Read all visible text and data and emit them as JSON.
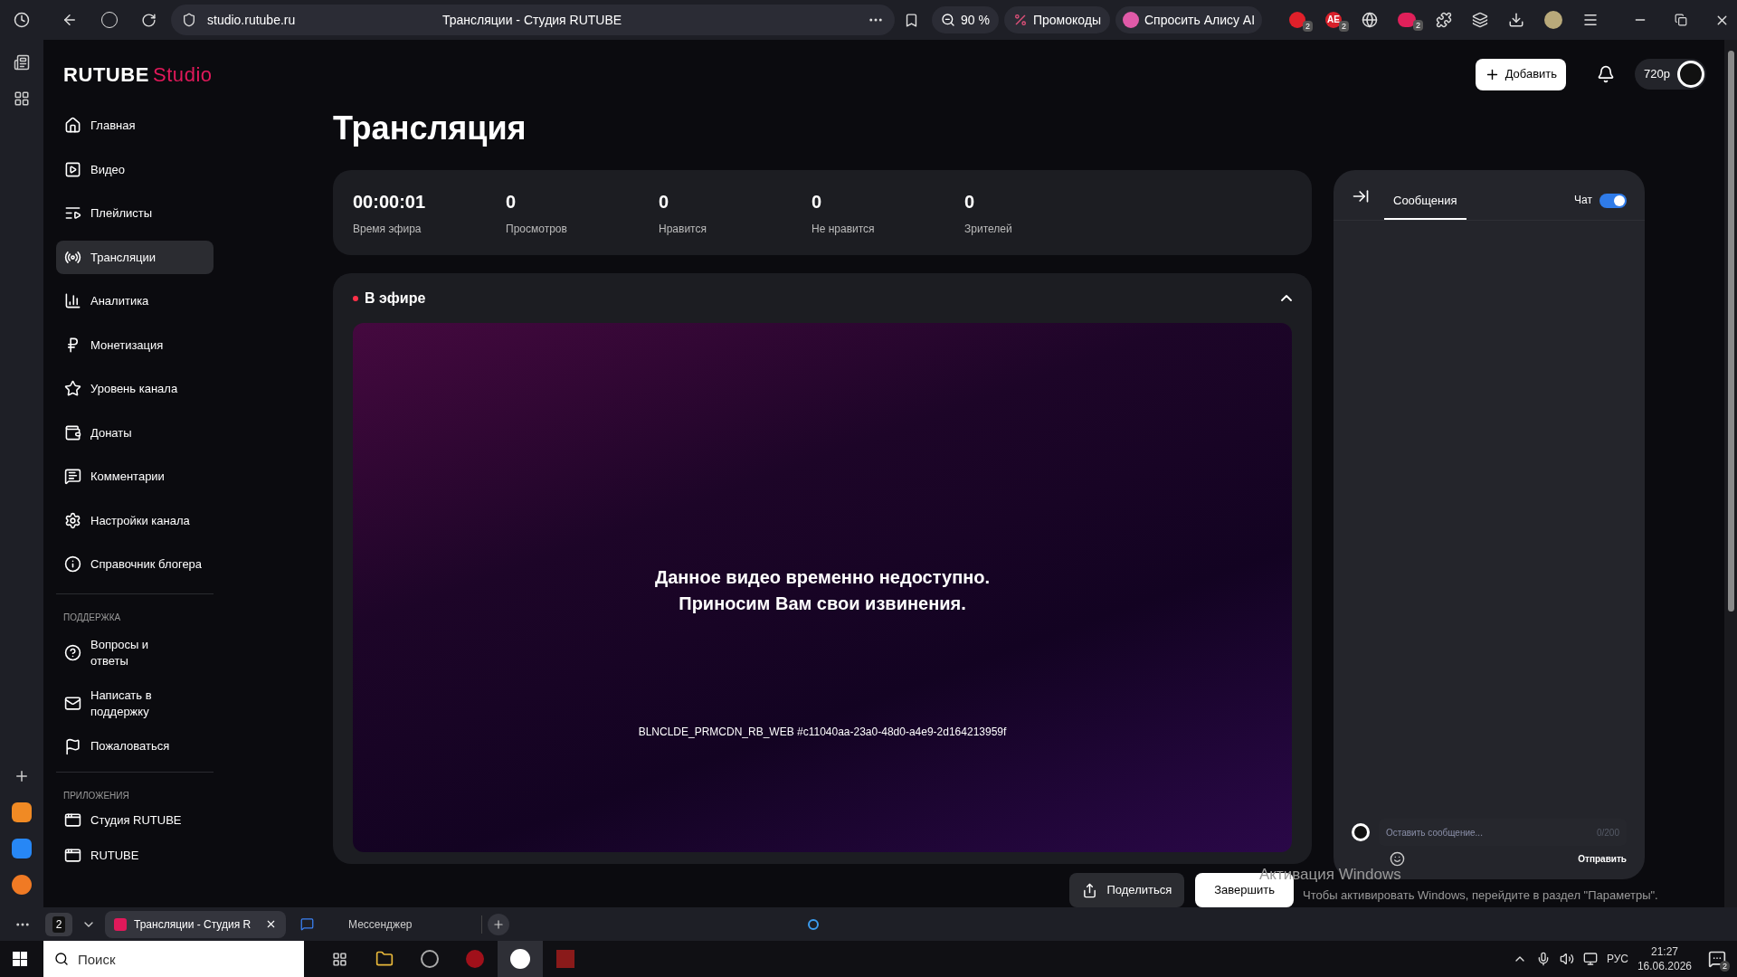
{
  "browser": {
    "url": "studio.rutube.ru",
    "title": "Трансляции - Студия RUTUBE",
    "zoom": "90 %",
    "promo": "Промокоды",
    "alice": "Спросить Алису AI",
    "extensions": [
      {
        "kind": "red",
        "badge": "2"
      },
      {
        "kind": "text",
        "text": "AE",
        "badge": "2"
      },
      {
        "kind": "globe"
      },
      {
        "kind": "pink",
        "badge": "2"
      },
      {
        "kind": "puzzle"
      },
      {
        "kind": "collections"
      },
      {
        "kind": "download"
      },
      {
        "kind": "avatar"
      },
      {
        "kind": "menu"
      }
    ]
  },
  "studio": {
    "logo": "RUTUBE",
    "logo_suffix": "Studio",
    "nav": [
      {
        "label": "Главная",
        "selected": false
      },
      {
        "label": "Видео",
        "selected": false
      },
      {
        "label": "Плейлисты",
        "selected": false
      },
      {
        "label": "Трансляции",
        "selected": true
      },
      {
        "label": "Аналитика",
        "selected": false
      },
      {
        "label": "Монетизация",
        "selected": false
      },
      {
        "label": "Уровень канала",
        "selected": false
      },
      {
        "label": "Донаты",
        "selected": false
      },
      {
        "label": "Комментарии",
        "selected": false
      },
      {
        "label": "Настройки канала",
        "selected": false
      },
      {
        "label": "Справочник блогера",
        "selected": false
      }
    ],
    "support": {
      "heading": "ПОДДЕРЖКА",
      "items": [
        "Вопросы и ответы",
        "Написать в поддержку",
        "Пожаловаться"
      ]
    },
    "apps": {
      "heading": "ПРИЛОЖЕНИЯ",
      "items": [
        "Студия RUTUBE",
        "RUTUBE"
      ]
    }
  },
  "header": {
    "add_button": "Добавить",
    "quality": "720p"
  },
  "page": {
    "title": "Трансляция",
    "stats": [
      {
        "value": "00:00:01",
        "label": "Время эфира"
      },
      {
        "value": "0",
        "label": "Просмотров"
      },
      {
        "value": "0",
        "label": "Нравится"
      },
      {
        "value": "0",
        "label": "Не нравится"
      },
      {
        "value": "0",
        "label": "Зрителей"
      }
    ],
    "stream": {
      "status": "В эфире",
      "expanded": true,
      "message": [
        "Данное видео временно недоступно.",
        "Приносим Вам свои извинения."
      ],
      "code": "BLNCLDE_PRMCDN_RB_WEB #c11040aa-23a0-48d0-a4e9-2d164213959f"
    },
    "actions": {
      "share": "Поделиться",
      "finish": "Завершить"
    }
  },
  "chat": {
    "tab": {
      "label": "Сообщения",
      "selected": true
    },
    "toggle": {
      "label": "Чат",
      "on": true
    },
    "placeholder": "Оставить сообщение...",
    "counter": "0/200",
    "send": "Отправить"
  },
  "activation": {
    "title": "Активация Windows",
    "text": "Чтобы активировать Windows, перейдите в раздел \"Параметры\"."
  },
  "tabbar": {
    "count": "2",
    "tabs": [
      {
        "title": "Трансляции - Студия R",
        "selected": true
      },
      {
        "title": "Мессенджер",
        "selected": false
      }
    ]
  },
  "taskbar": {
    "search": {
      "placeholder": "Поиск"
    },
    "lang": "РУС",
    "time": "21:27",
    "date": "16.06.2026",
    "notifications": "2"
  }
}
